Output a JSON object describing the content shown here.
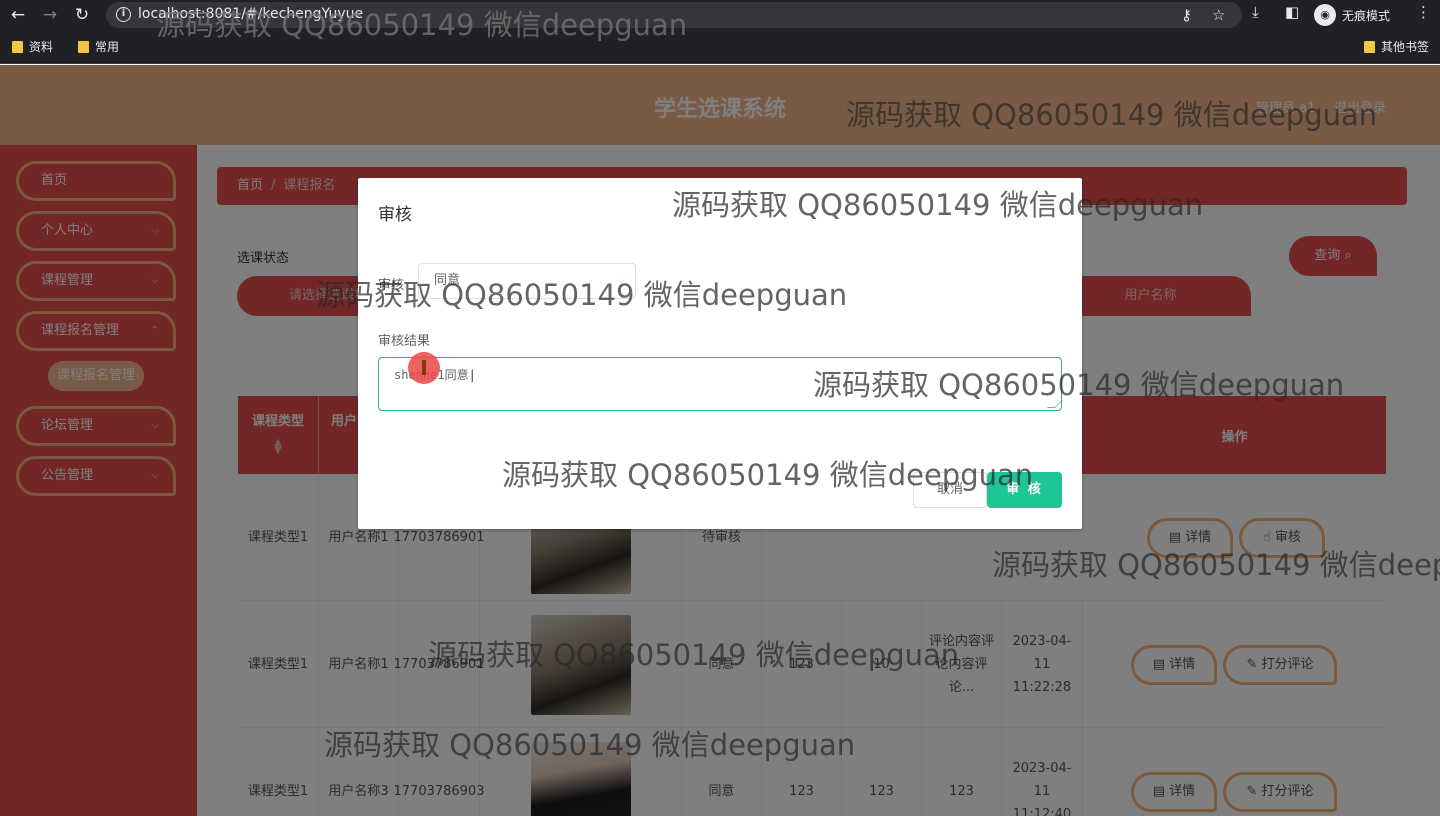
{
  "browser": {
    "url": "localhost:8081/#/kechengYuyue",
    "incognito_label": "无痕模式",
    "bookmarks": [
      "资料",
      "常用"
    ],
    "other_bookmarks": "其他书签"
  },
  "header": {
    "title": "学生选课系统",
    "user": "管理员 a1",
    "logout": "退出登录"
  },
  "sidebar": {
    "items": [
      {
        "label": "首页"
      },
      {
        "label": "个人中心"
      },
      {
        "label": "课程管理"
      },
      {
        "label": "课程报名管理"
      },
      {
        "label": "论坛管理"
      },
      {
        "label": "公告管理"
      }
    ],
    "sub_item": "课程报名管理"
  },
  "breadcrumb": {
    "home": "首页",
    "separator": "/",
    "current": "课程报名"
  },
  "filters": {
    "status_label": "选课状态",
    "status_placeholder": "请选择选课状态",
    "username_placeholder": "用户名称",
    "search_button": "查询"
  },
  "table": {
    "headers": [
      "课程类型",
      "用户",
      "操作"
    ],
    "rows": [
      {
        "course_type": "课程类型1",
        "user_name": "用户名称1",
        "phone": "17703786901",
        "status": "待审核",
        "col6": "",
        "col7": "",
        "comment": "",
        "time": "",
        "actions": [
          "详情",
          "审核"
        ]
      },
      {
        "course_type": "课程类型1",
        "user_name": "用户名称1",
        "phone": "17703786901",
        "status": "同意",
        "col6": "123",
        "col7": "10",
        "comment": "评论内容评论内容评论...",
        "time": "2023-04-11 11:22:28",
        "actions": [
          "详情",
          "打分评论"
        ]
      },
      {
        "course_type": "课程类型1",
        "user_name": "用户名称3",
        "phone": "17703786903",
        "status": "同意",
        "col6": "123",
        "col7": "123",
        "comment": "123",
        "time": "2023-04-11 11:12:40",
        "actions": [
          "详情",
          "打分评论"
        ]
      }
    ]
  },
  "dialog": {
    "title": "审核",
    "review_label": "审核",
    "review_value": "同意",
    "result_label": "审核结果",
    "result_value": "shenhe1同意",
    "cancel": "取消",
    "confirm": "审 核"
  },
  "watermark": "源码获取 QQ86050149 微信deepguan"
}
